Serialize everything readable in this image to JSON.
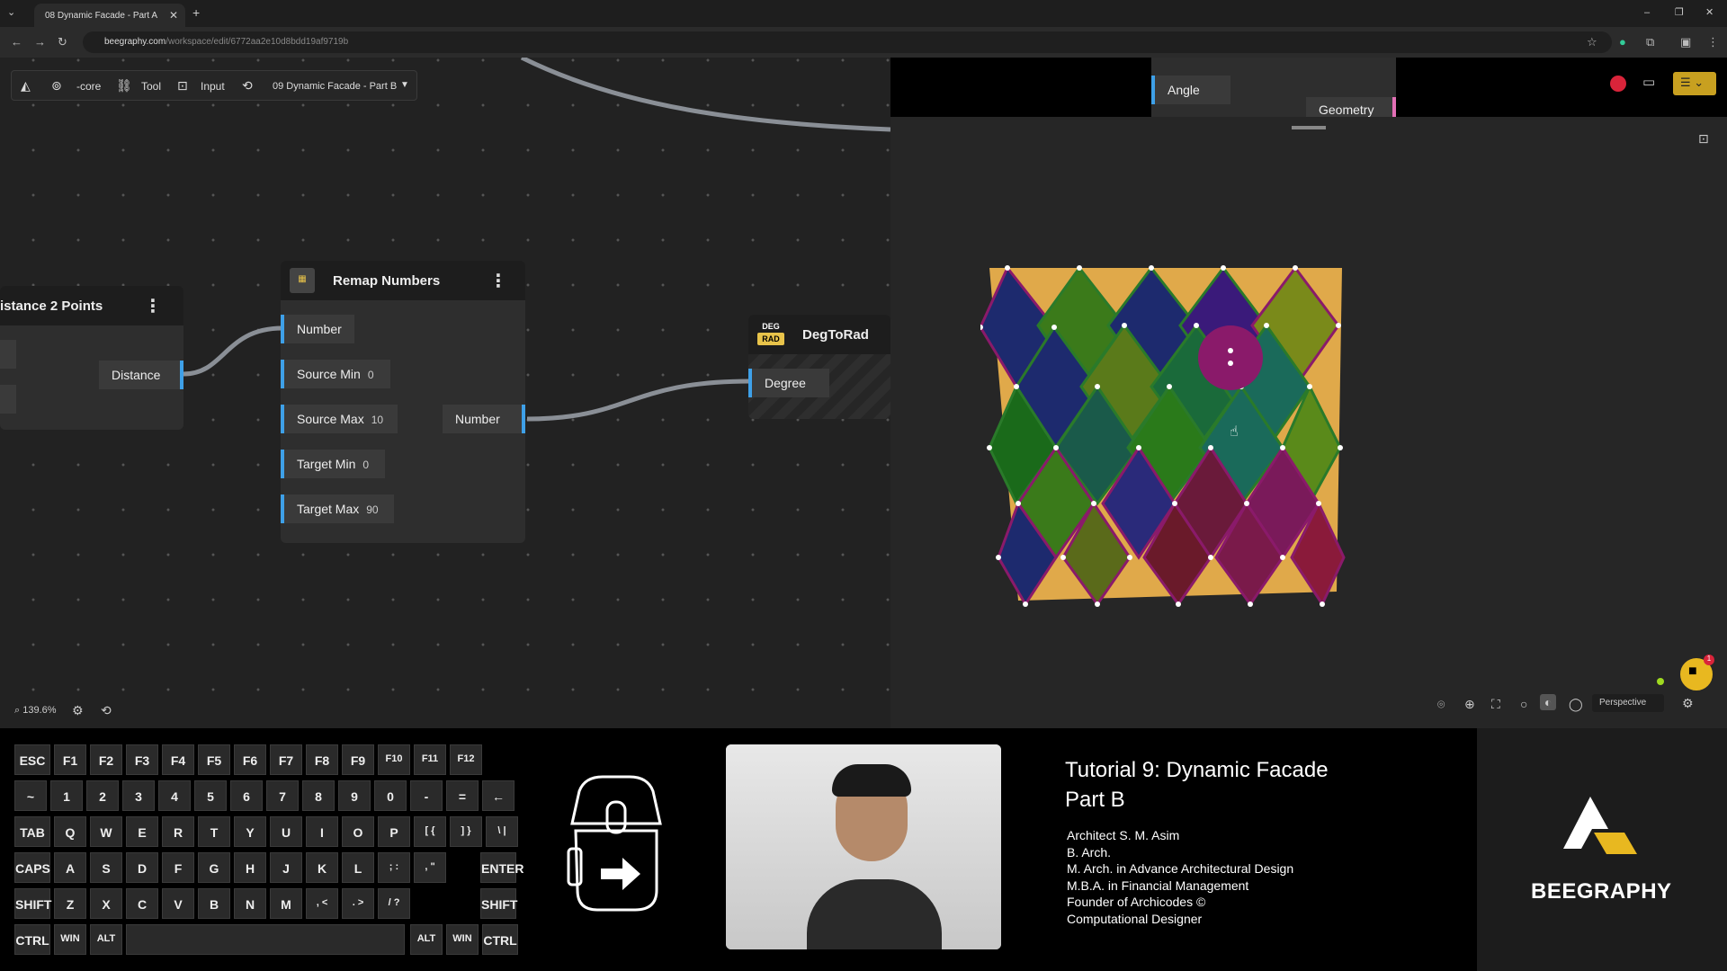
{
  "browser": {
    "tab_title": "08 Dynamic Facade - Part A",
    "tab_close": "✕",
    "new_tab": "+",
    "url_domain": "beegraphy.com",
    "url_path": "/workspace/edit/6772aa2e10d8bdd19af9719b",
    "window_controls": [
      "–",
      "❐",
      "✕"
    ]
  },
  "toolbar": {
    "core_label": "-core",
    "tool_label": "Tool",
    "input_label": "Input",
    "project_name": "09 Dynamic Facade - Part B"
  },
  "nodes": {
    "distance": {
      "title": "istance 2 Points",
      "output": "Distance"
    },
    "remap": {
      "title": "Remap Numbers",
      "inputs": [
        {
          "label": "Number",
          "value": ""
        },
        {
          "label": "Source Min",
          "value": "0"
        },
        {
          "label": "Source Max",
          "value": "10"
        },
        {
          "label": "Target Min",
          "value": "0"
        },
        {
          "label": "Target Max",
          "value": "90"
        }
      ],
      "output": "Number"
    },
    "degtorad": {
      "title": "DegToRad",
      "icon_top": "DEG",
      "icon_bottom": "RAD",
      "input": "Degree"
    },
    "angle": {
      "label": "Angle"
    },
    "geometry": {
      "label": "Geometry"
    }
  },
  "canvas_footer": {
    "zoom": "139.6%"
  },
  "viewport": {
    "view_mode": "Perspective",
    "notification_count": "1"
  },
  "keyboard": {
    "row1": [
      "ESC",
      "F1",
      "F2",
      "F3",
      "F4",
      "F5",
      "F6",
      "F7",
      "F8",
      "F9",
      "F10",
      "F11",
      "F12"
    ],
    "row2": [
      "~",
      "1",
      "2",
      "3",
      "4",
      "5",
      "6",
      "7",
      "8",
      "9",
      "0",
      "-",
      "=",
      "←"
    ],
    "row3": [
      "TAB",
      "Q",
      "W",
      "E",
      "R",
      "T",
      "Y",
      "U",
      "I",
      "O",
      "P",
      "[ {",
      "] }",
      "\\ |"
    ],
    "row4": [
      "CAPS",
      "A",
      "S",
      "D",
      "F",
      "G",
      "H",
      "J",
      "K",
      "L",
      "; :",
      ", \"",
      "ENTER"
    ],
    "row5": [
      "SHIFT",
      "Z",
      "X",
      "C",
      "V",
      "B",
      "N",
      "M",
      ", <",
      ". >",
      "/ ?",
      "SHIFT"
    ],
    "row6": [
      "CTRL",
      "WIN",
      "ALT",
      "ALT",
      "WIN",
      "CTRL"
    ]
  },
  "tutorial": {
    "title_line1": "Tutorial 9: Dynamic Facade",
    "title_line2": "Part B",
    "credits": [
      "Architect S. M. Asim",
      "B. Arch.",
      "M. Arch. in Advance Architectural Design",
      "M.B.A. in Financial Management",
      "Founder of Archicodes ©",
      "Computational Designer"
    ]
  },
  "brand": {
    "name": "BEEGRAPHY"
  },
  "colors": {
    "port_accent": "#3ea0e8",
    "facade_panel": "#e0a94a",
    "sphere": "#8a1a6a"
  }
}
